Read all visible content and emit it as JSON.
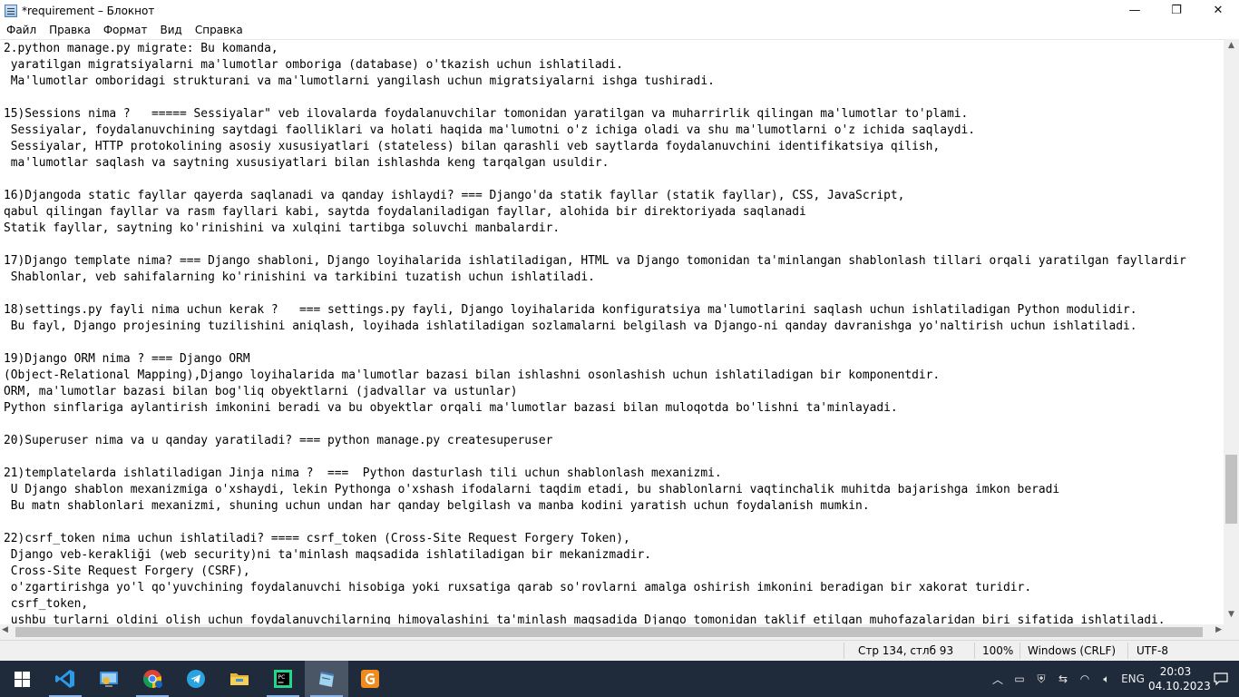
{
  "window": {
    "title": "*requirement – Блокнот",
    "minimize": "—",
    "maximize": "❐",
    "close": "✕"
  },
  "menu": [
    "Файл",
    "Правка",
    "Формат",
    "Вид",
    "Справка"
  ],
  "editor_text": "2.python manage.py migrate: Bu komanda,\n yaratilgan migratsiyalarni ma'lumotlar omboriga (database) o'tkazish uchun ishlatiladi.\n Ma'lumotlar omboridagi strukturani va ma'lumotlarni yangilash uchun migratsiyalarni ishga tushiradi.\n\n15)Sessions nima ?   ===== Sessiyalar\" veb ilovalarda foydalanuvchilar tomonidan yaratilgan va muharrirlik qilingan ma'lumotlar to'plami.\n Sessiyalar, foydalanuvchining saytdagi faolliklari va holati haqida ma'lumotni o'z ichiga oladi va shu ma'lumotlarni o'z ichida saqlaydi.\n Sessiyalar, HTTP protokolining asosiy xususiyatlari (stateless) bilan qarashli veb saytlarda foydalanuvchini identifikatsiya qilish,\n ma'lumotlar saqlash va saytning xususiyatlari bilan ishlashda keng tarqalgan usuldir.\n\n16)Djangoda static fayllar qayerda saqlanadi va qanday ishlaydi? === Django'da statik fayllar (statik fayllar), CSS, JavaScript,\nqabul qilingan fayllar va rasm fayllari kabi, saytda foydalaniladigan fayllar, alohida bir direktoriyada saqlanadi\nStatik fayllar, saytning ko'rinishini va xulqini tartibga soluvchi manbalardir.\n\n17)Django template nima? === Django shabloni, Django loyihalarida ishlatiladigan, HTML va Django tomonidan ta'minlangan shablonlash tillari orqali yaratilgan fayllardir\n Shablonlar, veb sahifalarning ko'rinishini va tarkibini tuzatish uchun ishlatiladi.\n\n18)settings.py fayli nima uchun kerak ?   === settings.py fayli, Django loyihalarida konfiguratsiya ma'lumotlarini saqlash uchun ishlatiladigan Python modulidir.\n Bu fayl, Django projesining tuzilishini aniqlash, loyihada ishlatiladigan sozlamalarni belgilash va Django-ni qanday davranishga yo'naltirish uchun ishlatiladi.\n\n19)Django ORM nima ? === Django ORM\n(Object-Relational Mapping),Django loyihalarida ma'lumotlar bazasi bilan ishlashni osonlashish uchun ishlatiladigan bir komponentdir.\nORM, ma'lumotlar bazasi bilan bog'liq obyektlarni (jadvallar va ustunlar)\nPython sinflariga aylantirish imkonini beradi va bu obyektlar orqali ma'lumotlar bazasi bilan muloqotda bo'lishni ta'minlayadi.\n\n20)Superuser nima va u qanday yaratiladi? === python manage.py createsuperuser\n\n21)templatelarda ishlatiladigan Jinja nima ?  ===  Python dasturlash tili uchun shablonlash mexanizmi.\n U Django shablon mexanizmiga o'xshaydi, lekin Pythonga o'xshash ifodalarni taqdim etadi, bu shablonlarni vaqtinchalik muhitda bajarishga imkon beradi\n Bu matn shablonlari mexanizmi, shuning uchun undan har qanday belgilash va manba kodini yaratish uchun foydalanish mumkin.\n\n22)csrf_token nima uchun ishlatiladi? ==== csrf_token (Cross-Site Request Forgery Token),\n Django veb-kerakliği (web security)ni ta'minlash maqsadida ishlatiladigan bir mekanizmadir.\n Cross-Site Request Forgery (CSRF),\n o'zgartirishga yo'l qo'yuvchining foydalanuvchi hisobiga yoki ruxsatiga qarab so'rovlarni amalga oshirish imkonini beradigan bir xakorat turidir.\n csrf_token,\n ushbu turlarni oldini olish uchun foydalanuvchilarning himoyalashini ta'minlash maqsadida Django tomonidan taklif etilgan muhofazalaridan biri sifatida ishlatiladi.",
  "status": {
    "position": "Стр 134, стлб 93",
    "zoom": "100%",
    "line_endings": "Windows (CRLF)",
    "encoding": "UTF-8"
  },
  "taskbar": {
    "apps": [
      "windows-start",
      "vscode",
      "control-panel",
      "chrome",
      "telegram",
      "file-explorer",
      "pycharm",
      "notepad",
      "vlc-like"
    ],
    "language": "ENG",
    "time": "20:03",
    "date": "04.10.2023"
  }
}
